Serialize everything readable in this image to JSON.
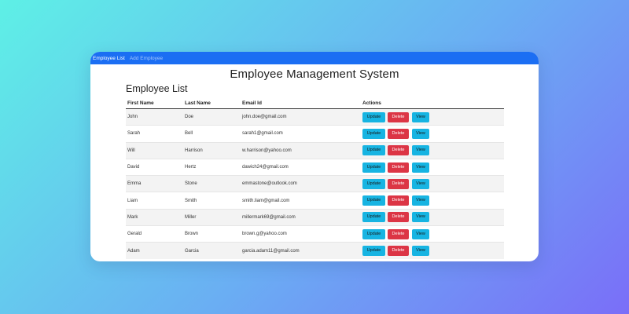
{
  "navbar": {
    "links": [
      "Employee List",
      "Add Employee"
    ]
  },
  "page": {
    "heading": "Employee Management System",
    "list_title": "Employee List"
  },
  "table": {
    "columns": [
      "First Name",
      "Last Name",
      "Email Id",
      "Actions"
    ],
    "rows": [
      [
        "John",
        "Doe",
        "john.doe@gmail.com"
      ],
      [
        "Sarah",
        "Bell",
        "sarah1@gmail.com"
      ],
      [
        "Will",
        "Harrison",
        "w.harrison@yahoo.com"
      ],
      [
        "David",
        "Hertz",
        "dawich24@gmail.com"
      ],
      [
        "Emma",
        "Stone",
        "emmastone@outlook.com"
      ],
      [
        "Liam",
        "Smith",
        "smith.liam@gmail.com"
      ],
      [
        "Mark",
        "Miller",
        "millermark69@gmail.com"
      ],
      [
        "Gerald",
        "Brown",
        "brown.g@yahoo.com"
      ],
      [
        "Adam",
        "Garcia",
        "garcia.adam11@gmail.com"
      ]
    ],
    "action_labels": {
      "update": "Update",
      "delete": "Delete",
      "view": "View"
    }
  },
  "colors": {
    "navbar": "#1b6ef3",
    "update_button": "#17b4e2",
    "delete_button": "#dc3545",
    "view_button": "#17b4e2"
  }
}
